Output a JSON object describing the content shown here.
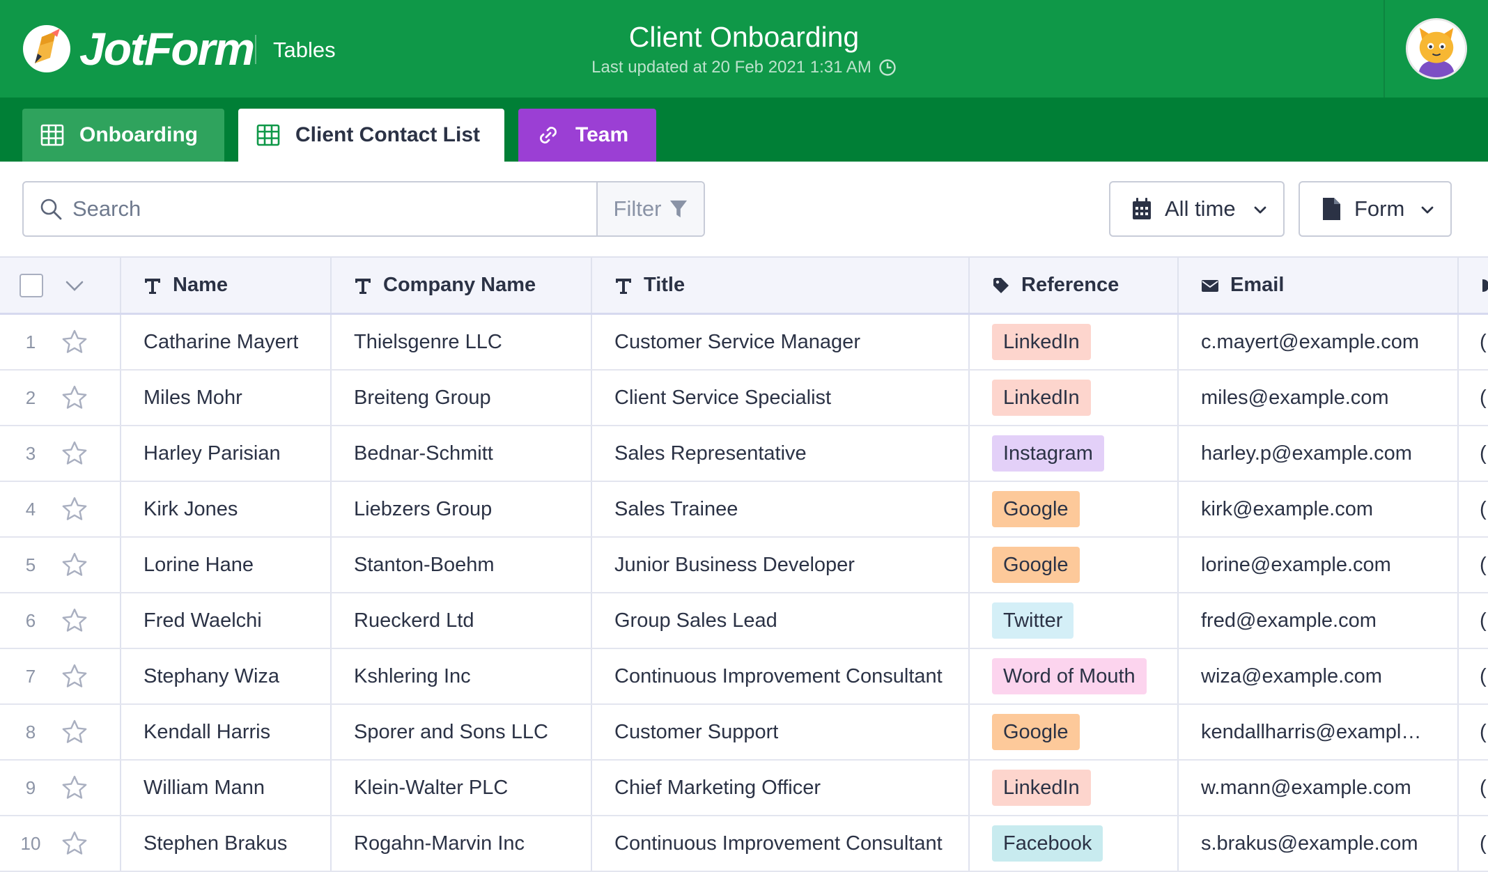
{
  "header": {
    "logo_text": "JotForm",
    "app_name": "Tables",
    "title": "Client Onboarding",
    "last_updated": "Last updated at 20 Feb 2021 1:31 AM",
    "brand_color": "#0f9848",
    "icons": {
      "logo": "jotform-pencil-logo",
      "clock": "clock-icon",
      "avatar": "user-avatar"
    }
  },
  "tabs": [
    {
      "label": "Onboarding",
      "icon": "grid-table-icon",
      "color": "#2fa35d"
    },
    {
      "label": "Client Contact List",
      "icon": "grid-table-icon",
      "active": true
    },
    {
      "label": "Team",
      "icon": "link-icon",
      "color": "#9b3fd4"
    }
  ],
  "toolbar": {
    "search_placeholder": "Search",
    "filter_label": "Filter",
    "time_dropdown_label": "All time",
    "form_dropdown_label": "Form"
  },
  "table": {
    "columns": [
      {
        "label": "Name",
        "icon": "text-type-icon"
      },
      {
        "label": "Company Name",
        "icon": "text-type-icon"
      },
      {
        "label": "Title",
        "icon": "text-type-icon"
      },
      {
        "label": "Reference",
        "icon": "tag-icon"
      },
      {
        "label": "Email",
        "icon": "envelope-icon"
      }
    ],
    "rows": [
      {
        "num": "1",
        "name": "Catharine Mayert",
        "company": "Thielsgenre LLC",
        "title": "Customer Service Manager",
        "reference": "LinkedIn",
        "email": "c.mayert@example.com",
        "phone_peek": "("
      },
      {
        "num": "2",
        "name": "Miles Mohr",
        "company": "Breiteng Group",
        "title": "Client Service Specialist",
        "reference": "LinkedIn",
        "email": "miles@example.com",
        "phone_peek": "("
      },
      {
        "num": "3",
        "name": "Harley Parisian",
        "company": "Bednar-Schmitt",
        "title": "Sales Representative",
        "reference": "Instagram",
        "email": "harley.p@example.com",
        "phone_peek": "("
      },
      {
        "num": "4",
        "name": "Kirk Jones",
        "company": "Liebzers Group",
        "title": "Sales Trainee",
        "reference": "Google",
        "email": "kirk@example.com",
        "phone_peek": "("
      },
      {
        "num": "5",
        "name": "Lorine Hane",
        "company": "Stanton-Boehm",
        "title": "Junior Business Developer",
        "reference": "Google",
        "email": "lorine@example.com",
        "phone_peek": "("
      },
      {
        "num": "6",
        "name": "Fred Waelchi",
        "company": "Rueckerd Ltd",
        "title": "Group Sales Lead",
        "reference": "Twitter",
        "email": "fred@example.com",
        "phone_peek": "("
      },
      {
        "num": "7",
        "name": "Stephany Wiza",
        "company": "Kshlering Inc",
        "title": "Continuous Improvement Consultant",
        "reference": "Word of Mouth",
        "email": "wiza@example.com",
        "phone_peek": "("
      },
      {
        "num": "8",
        "name": "Kendall Harris",
        "company": "Sporer and Sons LLC",
        "title": "Customer Support",
        "reference": "Google",
        "email": "kendallharris@example....",
        "phone_peek": "("
      },
      {
        "num": "9",
        "name": "William Mann",
        "company": "Klein-Walter PLC",
        "title": "Chief Marketing Officer",
        "reference": "LinkedIn",
        "email": "w.mann@example.com",
        "phone_peek": "("
      },
      {
        "num": "10",
        "name": "Stephen Brakus",
        "company": "Rogahn-Marvin Inc",
        "title": "Continuous Improvement Consultant",
        "reference": "Facebook",
        "email": "s.brakus@example.com",
        "phone_peek": "("
      }
    ],
    "reference_colors": {
      "LinkedIn": "#fdd5cd",
      "Instagram": "#e3d0f8",
      "Google": "#fdc99a",
      "Twitter": "#d4eff7",
      "Word of Mouth": "#fcd4ee",
      "Facebook": "#c8ebef"
    }
  }
}
